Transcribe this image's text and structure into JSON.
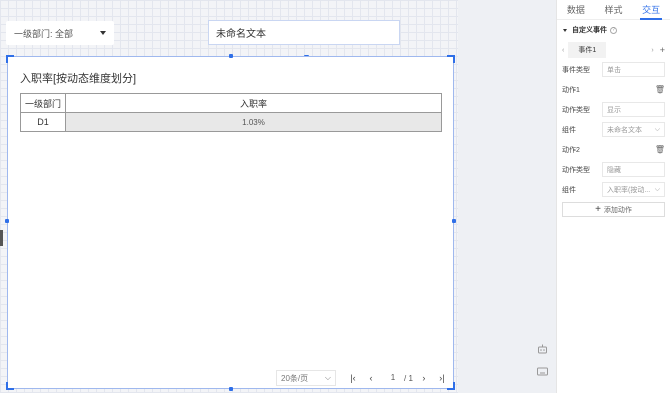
{
  "canvas": {
    "dept_filter": {
      "label": "一级部门: 全部"
    },
    "text_widget": {
      "text": "未命名文本"
    },
    "table_widget": {
      "title": "入职率[按动态维度划分]",
      "columns": [
        "一级部门",
        "入职率"
      ],
      "rows": [
        [
          "D1",
          "1.03%"
        ]
      ],
      "pagination": {
        "page_size": "20条/页",
        "current_page": "1",
        "total_pages": "/ 1"
      }
    }
  },
  "panel": {
    "tabs": [
      "数据",
      "样式",
      "交互"
    ],
    "active_tab": "交互",
    "section_title": "自定义事件",
    "event_tab": "事件1",
    "event_type_label": "事件类型",
    "event_type_value": "单击",
    "actions": [
      {
        "title": "动作1",
        "type_label": "动作类型",
        "type_value": "显示",
        "component_label": "组件",
        "component_value": "未命名文本"
      },
      {
        "title": "动作2",
        "type_label": "动作类型",
        "type_value": "隐藏",
        "component_label": "组件",
        "component_value": "入职率(按动..."
      }
    ],
    "add_action": "添加动作"
  },
  "colors": {
    "accent": "#2f6fe8"
  },
  "icons": [
    "chevron-down-icon",
    "first-page-icon",
    "prev-page-icon",
    "next-page-icon",
    "last-page-icon",
    "trash-icon",
    "plus-icon",
    "help-icon",
    "robot-icon",
    "keyboard-icon"
  ]
}
